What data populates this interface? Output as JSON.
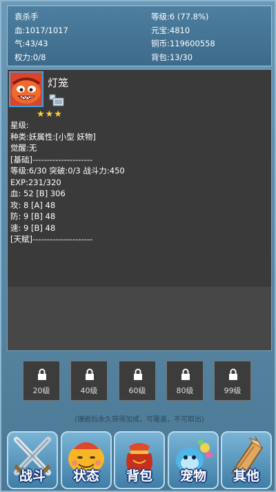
{
  "status": {
    "name": "袁杀手",
    "hp": "血:1017/1017",
    "qi": "气:43/43",
    "power": "权力:0/8",
    "level": "等级:6 (77.8%)",
    "yuanbao": "元宝:4810",
    "copper": "铜币:119600558",
    "bag": "背包:13/30"
  },
  "pet": {
    "name": "灯笼",
    "stars": "★★★",
    "star_label": "星级:",
    "type": "种类:妖属性:[小型 妖物]",
    "awaken": "觉醒:无",
    "basic_header": "[基础]---------------------",
    "level_line": "等级:6/30 突破:0/3 战斗力:450",
    "exp": "EXP:231/320",
    "hp": "血: 52 [B] 306",
    "atk": "攻: 8 [A] 48",
    "def": "防: 9 [B] 48",
    "spd": "速: 9 [B] 48",
    "talent_header": "[天赋]---------------------"
  },
  "slots": [
    "20级",
    "40级",
    "60级",
    "80级",
    "99级"
  ],
  "notice": "(镶嵌后永久获得加成，可覆盖，不可取出)",
  "nav": {
    "battle": "战斗",
    "status": "状态",
    "bag": "背包",
    "pet": "宠物",
    "other": "其他"
  },
  "icons": {
    "battle": "crossed-swords-icon",
    "status": "smiling-face-icon",
    "bag": "red-sack-icon",
    "pet": "blue-pet-icon",
    "other": "broken-wood-icon",
    "lock": "lock-icon"
  }
}
